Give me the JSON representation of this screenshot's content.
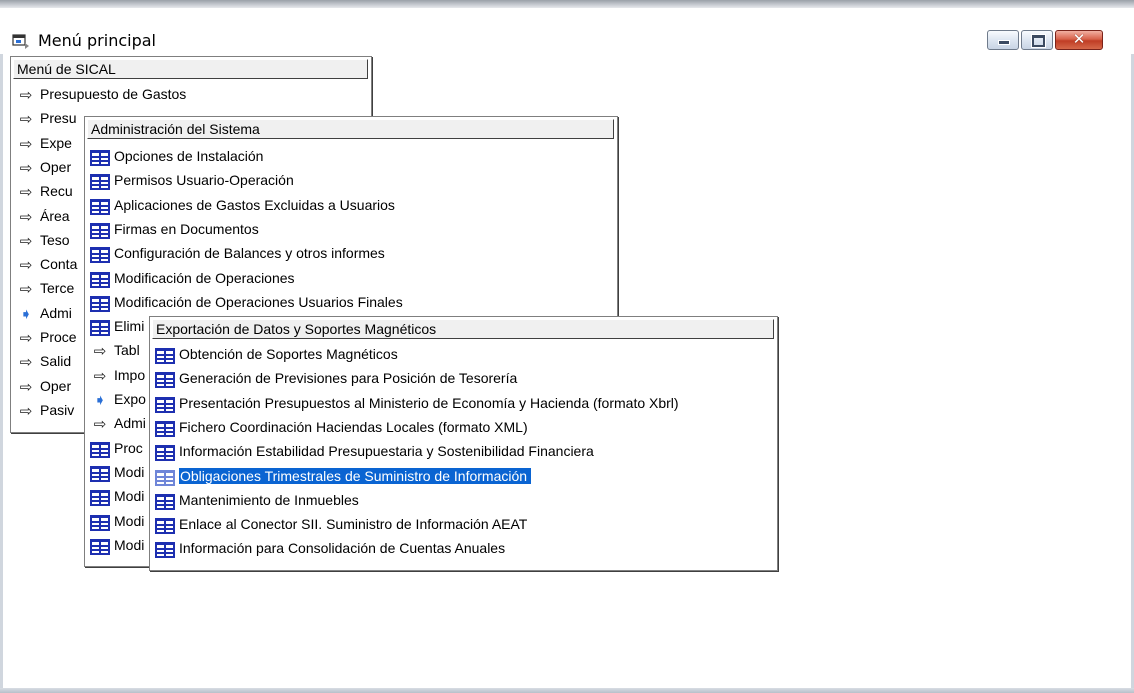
{
  "window": {
    "title": "Menú principal",
    "buttons": {
      "minimize": "minimize",
      "maximize": "maximize",
      "close": "✕"
    }
  },
  "menu1": {
    "header": "Menú de SICAL",
    "items": [
      {
        "label": "Presupuesto de Gastos",
        "icon": "arrow-icon"
      },
      {
        "label": "Presu",
        "icon": "arrow-icon"
      },
      {
        "label": "Expe",
        "icon": "arrow-icon"
      },
      {
        "label": "Oper",
        "icon": "arrow-icon"
      },
      {
        "label": "Recu",
        "icon": "arrow-icon"
      },
      {
        "label": "Área",
        "icon": "arrow-icon"
      },
      {
        "label": "Teso",
        "icon": "arrow-icon"
      },
      {
        "label": "Conta",
        "icon": "arrow-icon"
      },
      {
        "label": "Terce",
        "icon": "arrow-icon"
      },
      {
        "label": "Admi",
        "icon": "arrow-icon",
        "active": true
      },
      {
        "label": "Proce",
        "icon": "arrow-icon"
      },
      {
        "label": "Salid",
        "icon": "arrow-icon"
      },
      {
        "label": "Oper",
        "icon": "arrow-icon"
      },
      {
        "label": "Pasiv",
        "icon": "arrow-icon"
      }
    ]
  },
  "menu2": {
    "header": "Administración del Sistema",
    "items": [
      {
        "label": "Opciones de Instalación",
        "icon": "form-icon"
      },
      {
        "label": "Permisos Usuario-Operación",
        "icon": "form-icon"
      },
      {
        "label": "Aplicaciones de Gastos Excluidas a Usuarios",
        "icon": "form-icon"
      },
      {
        "label": "Firmas en Documentos",
        "icon": "form-icon"
      },
      {
        "label": "Configuración de Balances y otros informes",
        "icon": "form-icon"
      },
      {
        "label": "Modificación de Operaciones",
        "icon": "form-icon"
      },
      {
        "label": "Modificación de Operaciones Usuarios Finales",
        "icon": "form-icon"
      },
      {
        "label": "Elimi",
        "icon": "form-icon"
      },
      {
        "label": "Tabl",
        "icon": "arrow-icon"
      },
      {
        "label": "Impo",
        "icon": "arrow-icon"
      },
      {
        "label": "Expo",
        "icon": "arrow-icon",
        "active": true
      },
      {
        "label": "Admi",
        "icon": "arrow-icon"
      },
      {
        "label": "Proc",
        "icon": "form-icon"
      },
      {
        "label": "Modi",
        "icon": "form-icon"
      },
      {
        "label": "Modi",
        "icon": "form-icon"
      },
      {
        "label": "Modi",
        "icon": "form-icon"
      },
      {
        "label": "Modi",
        "icon": "form-icon"
      }
    ]
  },
  "menu3": {
    "header": "Exportación de Datos y Soportes Magnéticos",
    "items": [
      {
        "label": "Obtención  de  Soportes  Magnéticos",
        "icon": "form-icon"
      },
      {
        "label": "Generación de Previsiones para Posición de Tesorería",
        "icon": "form-icon"
      },
      {
        "label": "Presentación Presupuestos al Ministerio de Economía y Hacienda (formato Xbrl)",
        "icon": "form-icon"
      },
      {
        "label": "Fichero Coordinación Haciendas Locales (formato XML)",
        "icon": "form-icon"
      },
      {
        "label": "Información Estabilidad Presupuestaria y Sostenibilidad Financiera",
        "icon": "form-icon"
      },
      {
        "label": "Obligaciones Trimestrales de Suministro de Información",
        "icon": "form-icon",
        "selected": true
      },
      {
        "label": "Mantenimiento de Inmuebles",
        "icon": "form-icon"
      },
      {
        "label": "Enlace al Conector SII. Suministro de Información AEAT",
        "icon": "form-icon"
      },
      {
        "label": "Información para Consolidación de Cuentas Anuales",
        "icon": "form-icon"
      }
    ]
  },
  "colors": {
    "selection": "#0a64d2",
    "icon_blue": "#1d2fb0",
    "active_arrow": "#2a6fd6"
  }
}
